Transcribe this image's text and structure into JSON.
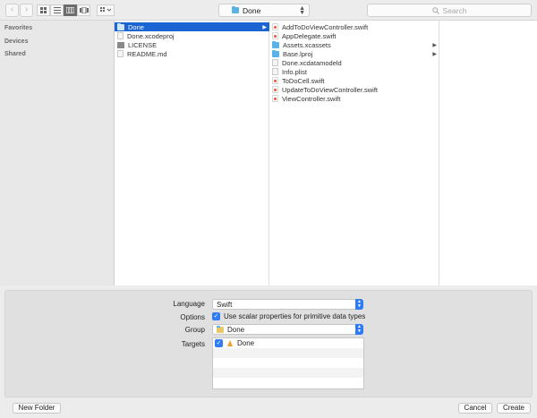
{
  "toolbar": {
    "back_glyph": "‹",
    "forward_glyph": "›",
    "views": [
      {
        "icon": "icon-view-icon",
        "selected": false
      },
      {
        "icon": "list-view-icon",
        "selected": false
      },
      {
        "icon": "column-view-icon",
        "selected": true
      },
      {
        "icon": "cover-flow-icon",
        "selected": false
      }
    ],
    "arrange_icon": "arrange-grid-icon",
    "location": "Done",
    "search_placeholder": "Search"
  },
  "sidebar": {
    "sections": [
      "Favorites",
      "Devices",
      "Shared"
    ]
  },
  "browser": {
    "column1": [
      {
        "name": "Done",
        "type": "folder",
        "selected": true,
        "has_children": true
      },
      {
        "name": "Done.xcodeproj",
        "type": "doc",
        "selected": false,
        "has_children": false
      },
      {
        "name": "LICENSE",
        "type": "dark",
        "selected": false,
        "has_children": false
      },
      {
        "name": "README.md",
        "type": "doc",
        "selected": false,
        "has_children": false
      }
    ],
    "column2": [
      {
        "name": "AddToDoViewController.swift",
        "type": "swift",
        "has_children": false
      },
      {
        "name": "AppDelegate.swift",
        "type": "swift",
        "has_children": false
      },
      {
        "name": "Assets.xcassets",
        "type": "folder",
        "has_children": true
      },
      {
        "name": "Base.lproj",
        "type": "folder",
        "has_children": true
      },
      {
        "name": "Done.xcdatamodeld",
        "type": "doc",
        "has_children": false
      },
      {
        "name": "Info.plist",
        "type": "doc",
        "has_children": false
      },
      {
        "name": "ToDoCell.swift",
        "type": "swift",
        "has_children": false
      },
      {
        "name": "UpdateToDoViewController.swift",
        "type": "swift",
        "has_children": false
      },
      {
        "name": "ViewController.swift",
        "type": "swift",
        "has_children": false
      }
    ]
  },
  "options": {
    "language_label": "Language",
    "language_value": "Swift",
    "options_label": "Options",
    "scalar_checkbox_label": "Use scalar properties for primitive data types",
    "scalar_checked": true,
    "group_label": "Group",
    "group_value": "Done",
    "targets_label": "Targets",
    "targets": [
      {
        "name": "Done",
        "checked": true
      }
    ]
  },
  "footer": {
    "new_folder": "New Folder",
    "cancel": "Cancel",
    "create": "Create"
  },
  "colors": {
    "selection": "#1a64d3",
    "accent": "#2f7cf6",
    "folder": "#5bb2e6"
  }
}
